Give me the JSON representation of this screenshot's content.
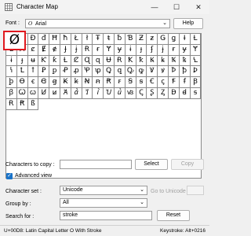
{
  "window": {
    "title": "Character Map",
    "minimize": "—",
    "maximize": "☐",
    "close": "✕"
  },
  "font": {
    "label": "Font :",
    "value": "Arial",
    "glyph": "O",
    "help_label": "Help"
  },
  "grid": {
    "rows": [
      [
        "Ø",
        "ø",
        "Đ",
        "đ",
        "Ħ",
        "ħ",
        "Ł",
        "ł",
        "Ŧ",
        "ŧ",
        "ƀ",
        "Ɓ",
        "Ƶ",
        "ƶ",
        "Ǥ",
        "ǥ",
        "Ɨ",
        "Ƚ"
      ],
      [
        "Ƚ",
        "Ⱥ",
        "ȼ",
        "Ɇ",
        "ɇ",
        "Ɉ",
        "ɉ",
        "Ɍ",
        "ɍ",
        "Ɏ",
        "ɏ",
        "ɨ",
        "ɟ",
        "ʄ",
        "ɉ",
        "ɍ",
        "ɏ",
        "Ɏ"
      ],
      [
        "ɨ",
        "ɟ",
        "ʉ",
        "Ƙ",
        "ƙ",
        "Ƚ",
        "Ȼ",
        "Ɋ",
        "ɋ",
        "Ʉ",
        "Ɍ",
        "Ꝁ",
        "ꝁ",
        "Ꝃ",
        "ꝃ",
        "Ꝅ",
        "ꝅ",
        "Ꝇ"
      ],
      [
        "ꝇ",
        "Ꝉ",
        "ꝉ",
        "Ꝑ",
        "ꝑ",
        "Ꝓ",
        "ꝓ",
        "Ꝕ",
        "ꝕ",
        "Ꝗ",
        "ꝗ",
        "Ꝙ",
        "ꝙ",
        "Ꝟ",
        "ꝟ",
        "Ꝥ",
        "ꝥ",
        "Ꝧ"
      ],
      [
        "ꝧ",
        "Ɵ",
        "ꞓ",
        "Ꞡ",
        "ꞡ",
        "Ꞣ",
        "ꞣ",
        "Ꞥ",
        "ꞥ",
        "Ꞧ",
        "ꞧ",
        "Ꞩ",
        "ꞩ",
        "Ꞓ",
        "ꞔ",
        "Ꞙ",
        "ꞙ",
        "Ꞵ"
      ],
      [
        "ꞵ",
        "Ꞷ",
        "ꞷ",
        "Ꞹ",
        "ꞹ",
        "Ꞻ",
        "ꞻ",
        "Ꞽ",
        "ꞽ",
        "Ꞿ",
        "ꞿ",
        "ꟃ",
        "Ꞔ",
        "Ʂ",
        "Ᶎ",
        "Ꟈ",
        "ꟈ",
        "ꟊ"
      ],
      [
        "Ɍ",
        "Ꞧ",
        "ß",
        "",
        "",
        "",
        "",
        "",
        "",
        "",
        "",
        "",
        "",
        "",
        "",
        "",
        "",
        ""
      ]
    ]
  },
  "selected_char": "Ø",
  "copy_row": {
    "label": "Characters to copy :",
    "value": "",
    "select_label": "Select",
    "copy_label": "Copy"
  },
  "advanced": {
    "label": "Advanced view",
    "checked_glyph": "✓"
  },
  "charset": {
    "label": "Character set :",
    "value": "Unicode",
    "goto_label": "Go to Unicode :"
  },
  "groupby": {
    "label": "Group by :",
    "value": "All"
  },
  "search": {
    "label": "Search for :",
    "value": "stroke",
    "reset_label": "Reset"
  },
  "status": {
    "left": "U+00D8: Latin Capital Letter O With Stroke",
    "right": "Keystroke: Alt+0216"
  }
}
